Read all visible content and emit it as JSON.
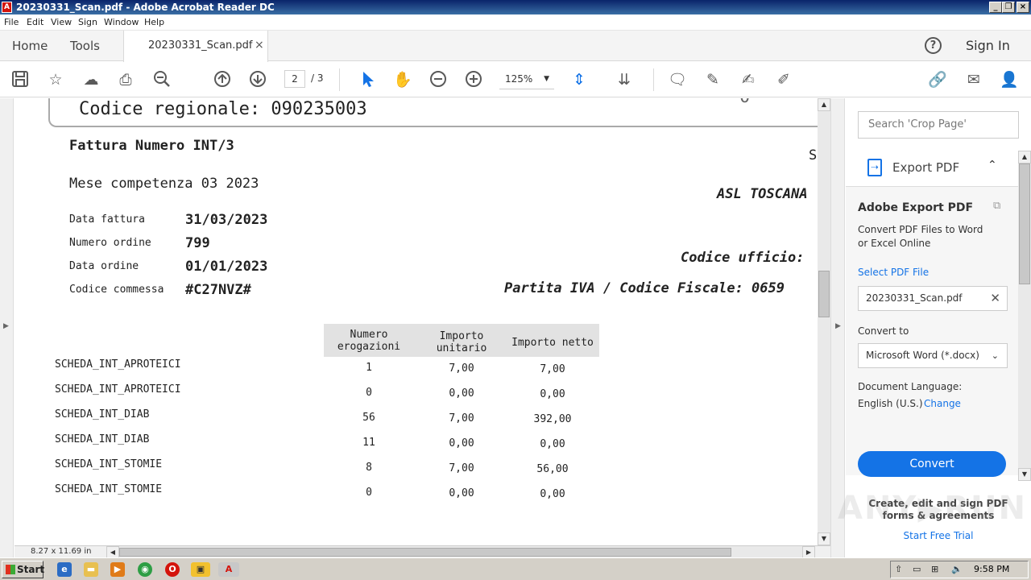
{
  "window": {
    "title": "20230331_Scan.pdf - Adobe Acrobat Reader DC"
  },
  "menu": [
    "File",
    "Edit",
    "View",
    "Sign",
    "Window",
    "Help"
  ],
  "tabs": {
    "home": "Home",
    "tools": "Tools",
    "document": "20230331_Scan.pdf",
    "help_icon": "?",
    "sign_in": "Sign In"
  },
  "toolbar": {
    "page_current": "2",
    "page_total": "/ 3",
    "zoom": "125%"
  },
  "document": {
    "codice_regionale": "Codice regionale: 090235003",
    "top_right_fragment": "0",
    "fattura_numero": "Fattura Numero INT/3",
    "s_fragment": "S",
    "mese_competenza": "Mese competenza  03 2023",
    "asl": "ASL TOSCANA",
    "fields": [
      {
        "label": "Data fattura",
        "value": "31/03/2023"
      },
      {
        "label": "Numero ordine",
        "value": "799"
      },
      {
        "label": "Data ordine",
        "value": "01/01/2023"
      },
      {
        "label": "Codice commessa",
        "value": "#C27NVZ#"
      }
    ],
    "codice_ufficio": "Codice ufficio:",
    "partita_iva": "Partita IVA / Codice Fiscale: 0659",
    "table": {
      "headers": [
        "Numero erogazioni",
        "Importo unitario",
        "Importo netto"
      ],
      "rows": [
        {
          "label": "SCHEDA_INT_APROTEICI",
          "n": "1",
          "unit": "7,00",
          "net": "7,00"
        },
        {
          "label": "SCHEDA_INT_APROTEICI",
          "n": "0",
          "unit": "0,00",
          "net": "0,00"
        },
        {
          "label": "SCHEDA_INT_DIAB",
          "n": "56",
          "unit": "7,00",
          "net": "392,00"
        },
        {
          "label": "SCHEDA_INT_DIAB",
          "n": "11",
          "unit": "0,00",
          "net": "0,00"
        },
        {
          "label": "SCHEDA_INT_STOMIE",
          "n": "8",
          "unit": "7,00",
          "net": "56,00"
        },
        {
          "label": "SCHEDA_INT_STOMIE",
          "n": "0",
          "unit": "0,00",
          "net": "0,00"
        }
      ]
    }
  },
  "status": {
    "page_size": "8.27 x 11.69 in"
  },
  "right_pane": {
    "search_placeholder": "Search 'Crop Page'",
    "export_label": "Export PDF",
    "panel_title": "Adobe Export PDF",
    "panel_desc_1": "Convert PDF Files to Word",
    "panel_desc_2": "or Excel Online",
    "select_file": "Select PDF File",
    "file_name": "20230331_Scan.pdf",
    "convert_to": "Convert to",
    "convert_format": "Microsoft Word (*.docx)",
    "doc_language": "Document Language:",
    "language_value": "English (U.S.)",
    "change": "Change",
    "convert_button": "Convert",
    "promo_line1": "Create, edit and sign PDF",
    "promo_line2": "forms & agreements",
    "free_trial": "Start Free Trial"
  },
  "taskbar": {
    "start": "Start",
    "clock": "9:58 PM"
  },
  "colors": {
    "accent": "#1473e6",
    "title_bar": "#0a246a",
    "taskbar": "#d4d0c8"
  }
}
